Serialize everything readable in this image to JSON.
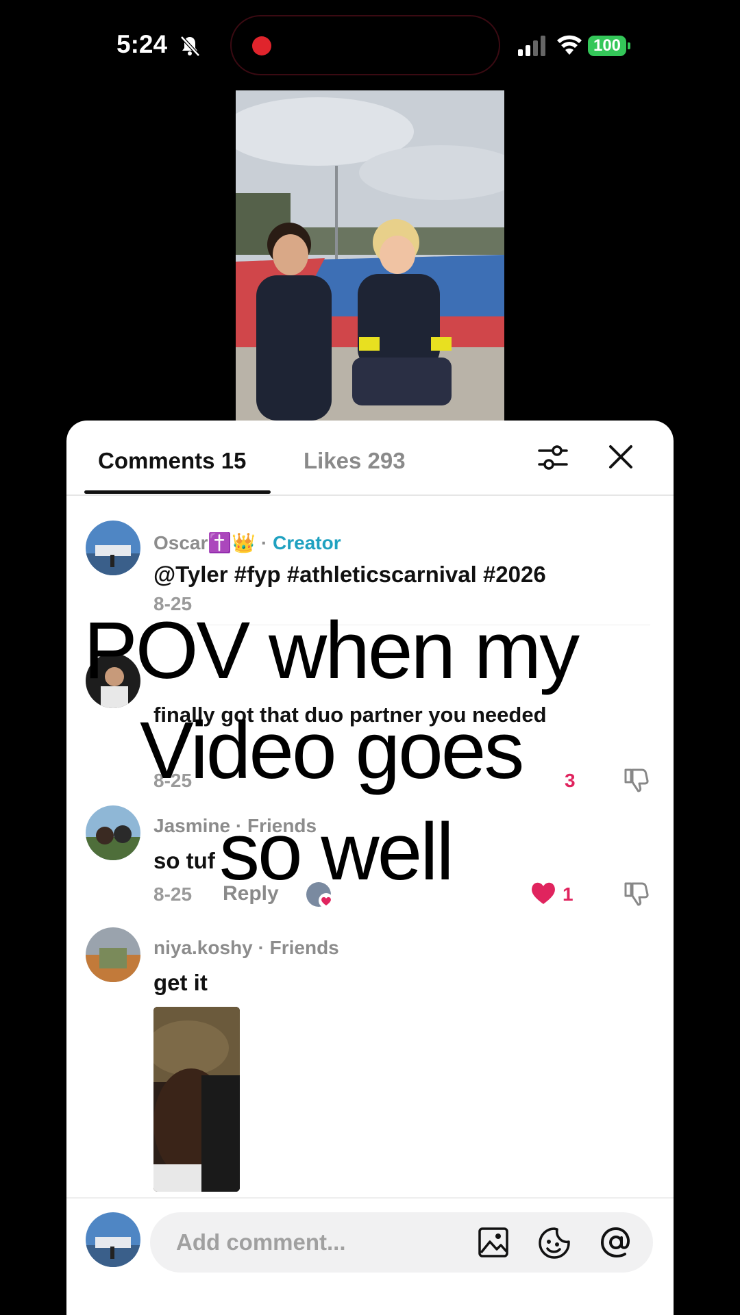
{
  "status_bar": {
    "time": "5:24",
    "battery": "100",
    "icons": [
      "bell-off-icon",
      "signal-icon",
      "wifi-icon",
      "battery-icon"
    ],
    "recording_color": "#e0242c"
  },
  "sheet": {
    "tabs": [
      {
        "label": "Comments 15",
        "active": true
      },
      {
        "label": "Likes 293",
        "active": false
      }
    ],
    "icons": [
      "filter-icon",
      "close-icon"
    ]
  },
  "comments": [
    {
      "user": "Oscar✝️👑",
      "badge": "Creator",
      "text": "@Tyler #fyp #athleticscarnival #2026",
      "date": "8-25"
    },
    {
      "text": "finally got that duo partner you needed",
      "date": "8-25",
      "likes": "3"
    },
    {
      "user": "Jasmine",
      "badge": "Friends",
      "text": "so tuf",
      "date": "8-25",
      "reply_label": "Reply",
      "likes": "1"
    },
    {
      "user": "niya.koshy",
      "badge": "Friends",
      "text": "get it"
    }
  ],
  "input": {
    "placeholder": "Add comment...",
    "icons": [
      "image-icon",
      "emoji-icon",
      "at-icon"
    ]
  },
  "overlay_caption": {
    "line1": "POV when my",
    "line2": "Video goes",
    "line3": "so well"
  },
  "colors": {
    "creator_badge": "#1fa1c0",
    "like_red": "#e0245e",
    "battery_green": "#34c759"
  }
}
